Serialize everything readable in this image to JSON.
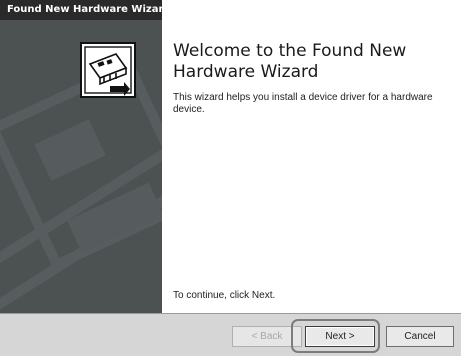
{
  "window": {
    "title": "Found New Hardware Wizard"
  },
  "side_panel": {
    "icon": "hardware-wizard-icon"
  },
  "content": {
    "heading": "Welcome to the Found New Hardware Wizard",
    "intro": "This wizard helps you install a device driver for a hardware device.",
    "continue_hint": "To continue, click Next."
  },
  "buttons": {
    "back_label": "< Back",
    "next_label": "Next >",
    "cancel_label": "Cancel"
  },
  "colors": {
    "titlebar": "#2a2a2a",
    "side_panel": "#4c5152",
    "footer": "#d6d6d6",
    "highlight": "#7c7c7c"
  }
}
